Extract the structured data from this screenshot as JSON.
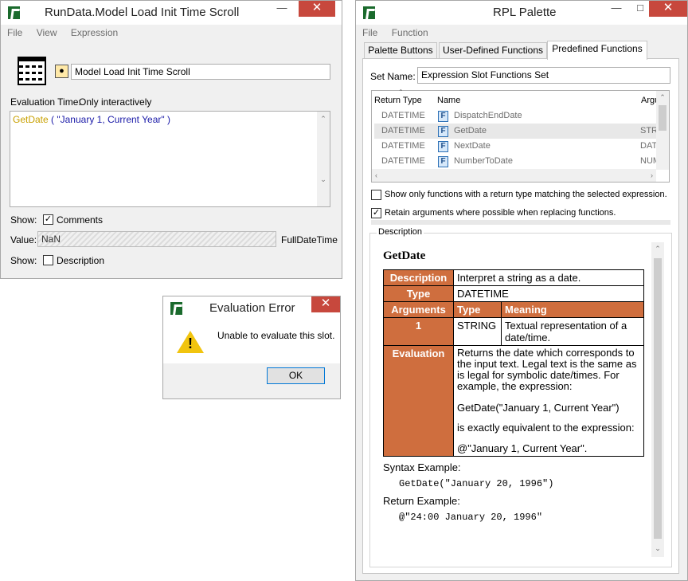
{
  "left_window": {
    "title": "RunData.Model Load Init Time Scroll",
    "menu": [
      "File",
      "View",
      "Expression"
    ],
    "name_value": "Model Load Init Time Scroll",
    "eval_time_label": "Evaluation Time:",
    "eval_time_value": "Only interactively",
    "expression": {
      "func": "GetDate",
      "open": " ( ",
      "arg": "\"January 1, Current Year\"",
      "close": " )"
    },
    "show_label": "Show:",
    "comments_label": "Comments",
    "comments_checked": "✓",
    "value_label": "Value:",
    "value": "NaN",
    "value_unit": "FullDateTime",
    "show2_label": "Show:",
    "description_label": "Description"
  },
  "error_dialog": {
    "title": "Evaluation Error",
    "message": "Unable to evaluate this slot.",
    "ok_label": "OK"
  },
  "rpl_palette": {
    "title": "RPL Palette",
    "menu": [
      "File",
      "Function"
    ],
    "tabs": [
      "Palette Buttons",
      "User-Defined Functions",
      "Predefined Functions"
    ],
    "set_name_label": "Set Name:",
    "set_name_value": "Expression Slot Functions Set",
    "columns": [
      "Return Type",
      "Name",
      "Argu"
    ],
    "rows": [
      {
        "type": "DATETIME",
        "name": "DispatchEndDate",
        "arg": ""
      },
      {
        "type": "DATETIME",
        "name": "GetDate",
        "arg": "STRI"
      },
      {
        "type": "DATETIME",
        "name": "NextDate",
        "arg": "DATE"
      },
      {
        "type": "DATETIME",
        "name": "NumberToDate",
        "arg": "NUM"
      }
    ],
    "opt1_label": "Show only functions with a return type matching the selected expression.",
    "opt2_label": "Retain arguments where possible when replacing functions.",
    "opt2_checked": "✓",
    "description_group": "Description",
    "doc": {
      "name": "GetDate",
      "description_h": "Description",
      "description": "Interpret a string as a date.",
      "type_h": "Type",
      "type": "DATETIME",
      "arguments_h": "Arguments",
      "arg_type_h": "Type",
      "arg_meaning_h": "Meaning",
      "arg_num": "1",
      "arg_type": "STRING",
      "arg_meaning": "Textual representation of a date/time.",
      "evaluation_h": "Evaluation",
      "eval_p1": "Returns the date which corresponds to the input text. Legal text is the same as is legal for symbolic date/times. For example, the expression:",
      "eval_p2": "GetDate(\"January 1, Current Year\")",
      "eval_p3": "is exactly equivalent to the expression:",
      "eval_p4": "@\"January 1, Current Year\".",
      "syntax_label": "Syntax Example:",
      "syntax": "GetDate(\"January 20, 1996\")",
      "return_label": "Return Example:",
      "return": "@\"24:00 January 20, 1996\""
    }
  }
}
